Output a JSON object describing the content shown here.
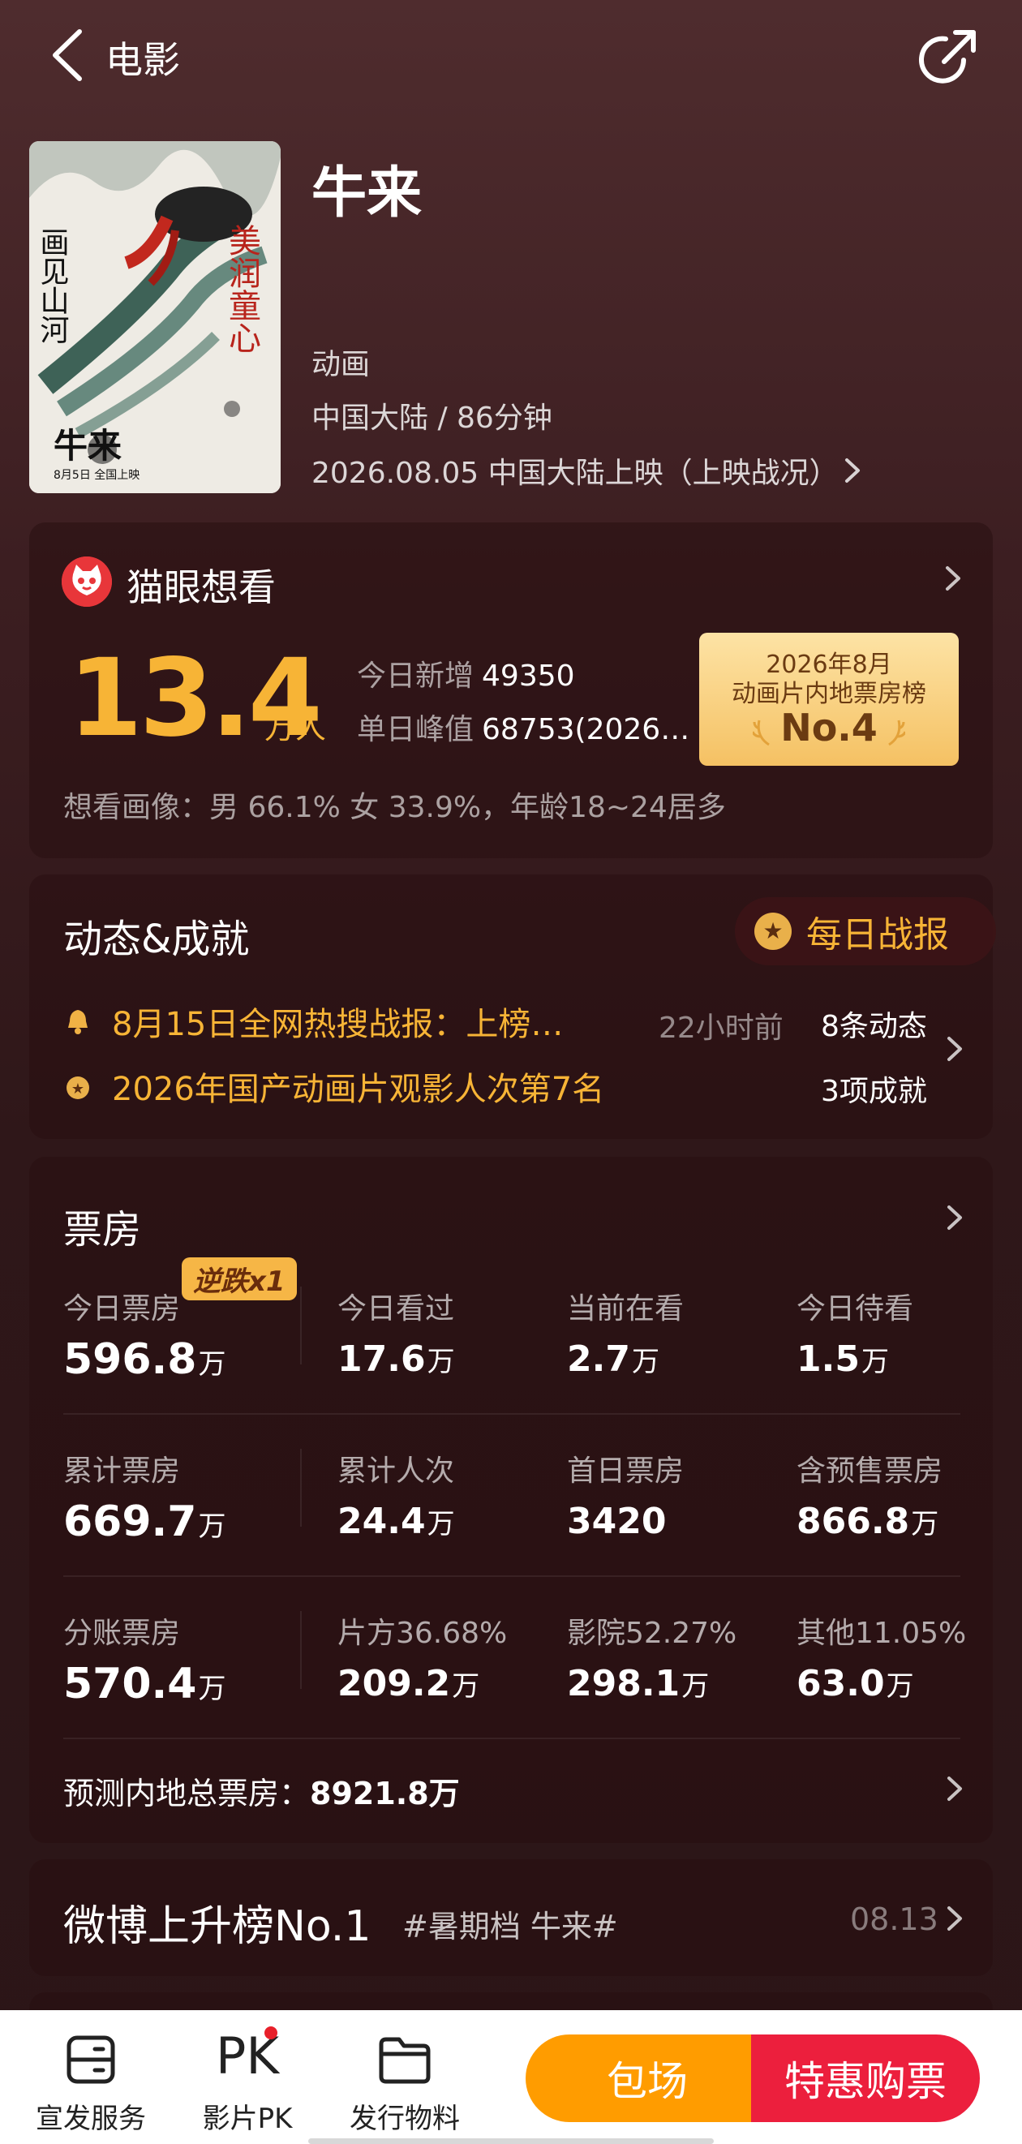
{
  "header": {
    "back_icon": "chevron-left-icon",
    "title": "电影",
    "share_icon": "share-icon"
  },
  "movie": {
    "title": "牛来",
    "genre": "动画",
    "region_duration": "中国大陆 / 86分钟",
    "release": "2026.08.05 中国大陆上映（上映战况）",
    "poster": {
      "text_left": "画见山河",
      "text_right": "美润童心",
      "text_title": "牛来",
      "text_date": "8月5日 全国上映"
    }
  },
  "want": {
    "title": "猫眼想看",
    "number": "13.4",
    "unit": "万人",
    "today_new_label": "今日新增",
    "today_new_value": "49350",
    "peak_label": "单日峰值",
    "peak_value": "68753(2026…",
    "rank_line1": "2026年8月",
    "rank_line2": "动画片内地票房榜",
    "rank_line3": "No.4",
    "profile": "想看画像：男 66.1%  女 33.9%，年龄18~24居多"
  },
  "dynamics": {
    "title": "动态&成就",
    "daily_report": "每日战报",
    "item1": "8月15日全网热搜战报：上榜…",
    "item1_time": "22小时前",
    "item1_count": "8条动态",
    "item2": "2026年国产动画片观影人次第7名",
    "item2_count": "3项成就"
  },
  "boxoffice": {
    "title": "票房",
    "reverse_badge": "逆跌x1",
    "row1": [
      {
        "label": "今日票房",
        "value": "596.8",
        "unit": "万"
      },
      {
        "label": "今日看过",
        "value": "17.6",
        "unit": "万"
      },
      {
        "label": "当前在看",
        "value": "2.7",
        "unit": "万"
      },
      {
        "label": "今日待看",
        "value": "1.5",
        "unit": "万"
      }
    ],
    "row2": [
      {
        "label": "累计票房",
        "value": "669.7",
        "unit": "万"
      },
      {
        "label": "累计人次",
        "value": "24.4",
        "unit": "万"
      },
      {
        "label": "首日票房",
        "value": "3420",
        "unit": ""
      },
      {
        "label": "含预售票房",
        "value": "866.8",
        "unit": "万"
      }
    ],
    "row3": [
      {
        "label": "分账票房",
        "value": "570.4",
        "unit": "万"
      },
      {
        "label": "片方36.68%",
        "value": "209.2",
        "unit": "万"
      },
      {
        "label": "影院52.27%",
        "value": "298.1",
        "unit": "万"
      },
      {
        "label": "其他11.05%",
        "value": "63.0",
        "unit": "万"
      }
    ],
    "forecast_label": "预测内地总票房：",
    "forecast_value": "8921.8万"
  },
  "weibo": {
    "title": "微博上升榜No.1",
    "tag": "#暑期档 牛来#",
    "date": "08.13"
  },
  "bottom_bar": {
    "tab1": "宣发服务",
    "tab2_icon_text": "PK",
    "tab2": "影片PK",
    "tab3": "发行物料",
    "book": "包场",
    "buy": "特惠购票"
  },
  "colors": {
    "accent_gold": "#f7b436",
    "book_orange": "#ff9c00",
    "buy_red": "#ec1f3d"
  }
}
